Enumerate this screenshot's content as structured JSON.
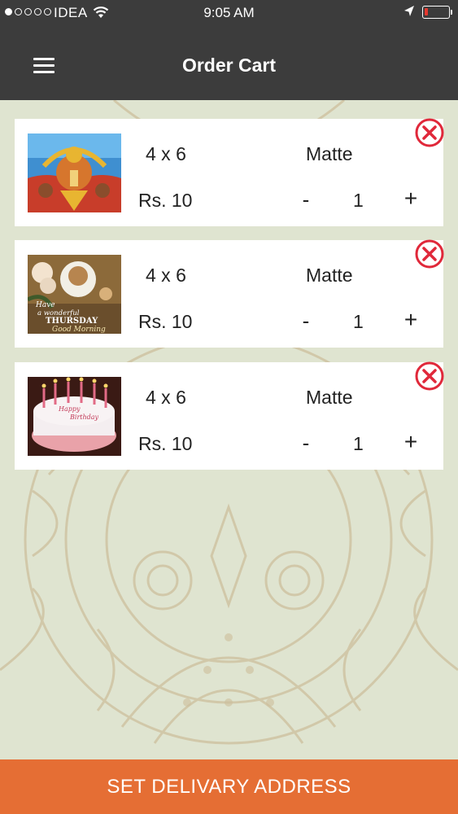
{
  "status_bar": {
    "carrier": "IDEA",
    "time": "9:05 AM",
    "battery_color": "#e5382e"
  },
  "nav": {
    "title": "Order Cart",
    "menu_icon": "hamburger-menu-icon"
  },
  "cart": {
    "items": [
      {
        "image": "hanuman-artwork",
        "size": "4 x 6",
        "paper": "Matte",
        "price": "Rs. 10",
        "quantity": "1",
        "minus": "-",
        "plus": "+"
      },
      {
        "image": "thursday-greeting",
        "size": "4 x 6",
        "paper": "Matte",
        "price": "Rs. 10",
        "quantity": "1",
        "minus": "-",
        "plus": "+"
      },
      {
        "image": "birthday-cake",
        "size": "4 x 6",
        "paper": "Matte",
        "price": "Rs. 10",
        "quantity": "1",
        "minus": "-",
        "plus": "+"
      }
    ],
    "thumb_texts": {
      "thursday_line1": "Have",
      "thursday_line2": "a wonderful",
      "thursday_line3": "THURSDAY",
      "thursday_line4": "Good Morning",
      "cake_line1": "Happy",
      "cake_line2": "Birthday"
    },
    "remove_icon_color": "#e0283a"
  },
  "cta": {
    "label": "SET DELIVARY ADDRESS",
    "color": "#e56e34"
  }
}
